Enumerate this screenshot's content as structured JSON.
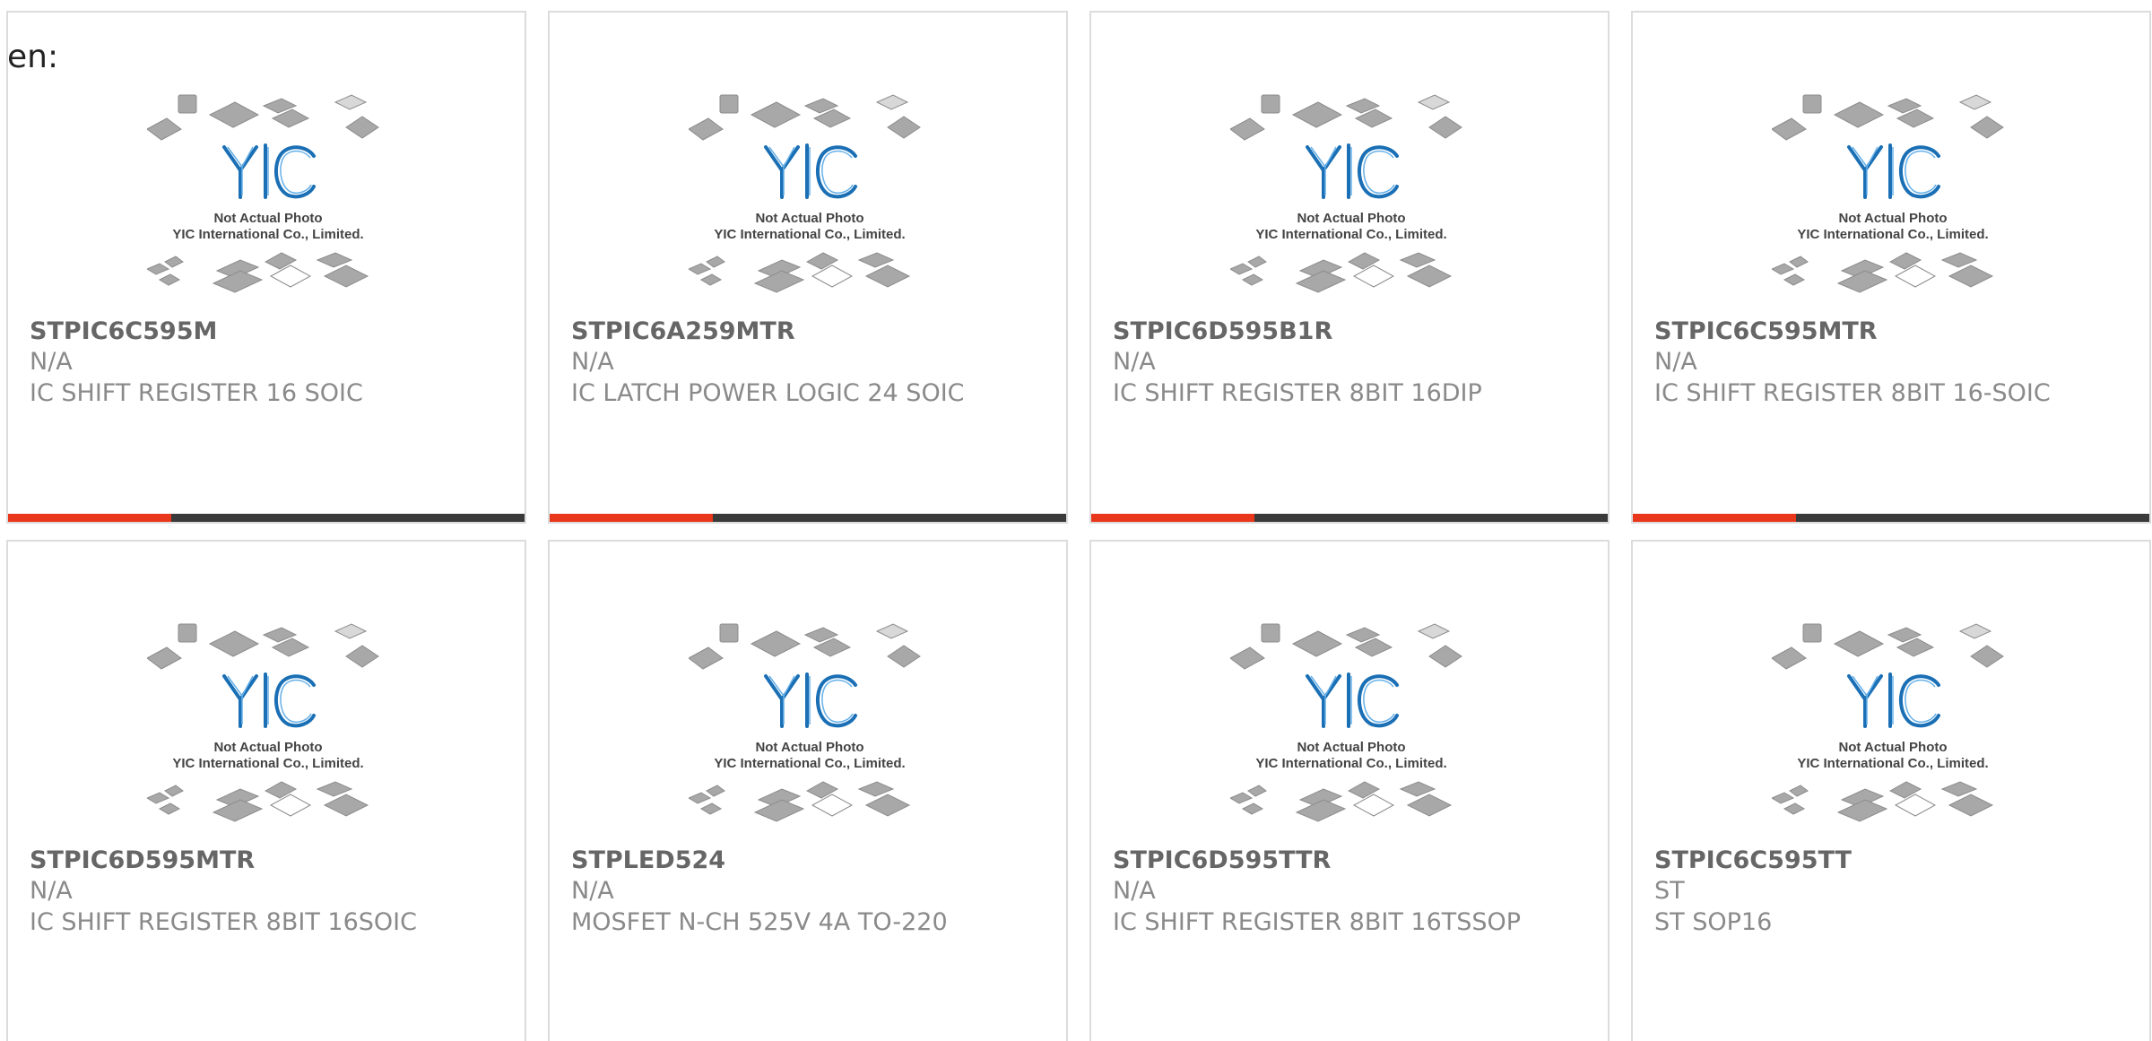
{
  "heading": "en:",
  "placeholder": {
    "caption_line1": "Not Actual Photo",
    "caption_line2": "YIC International Co., Limited.",
    "logo_text": "YIC"
  },
  "colors": {
    "accent": "#e8371b",
    "bar": "#3a3a3a",
    "logo_blue": "#1a6fb5"
  },
  "products": [
    {
      "part": "STPIC6C595M",
      "maker": "N/A",
      "desc": "IC SHIFT REGISTER 16 SOIC"
    },
    {
      "part": "STPIC6A259MTR",
      "maker": "N/A",
      "desc": "IC LATCH POWER LOGIC 24 SOIC"
    },
    {
      "part": "STPIC6D595B1R",
      "maker": "N/A",
      "desc": "IC SHIFT REGISTER 8BIT 16DIP"
    },
    {
      "part": "STPIC6C595MTR",
      "maker": "N/A",
      "desc": "IC SHIFT REGISTER 8BIT 16-SOIC"
    },
    {
      "part": "STPIC6D595MTR",
      "maker": "N/A",
      "desc": "IC SHIFT REGISTER 8BIT 16SOIC"
    },
    {
      "part": "STPLED524",
      "maker": "N/A",
      "desc": "MOSFET N-CH 525V 4A TO-220"
    },
    {
      "part": "STPIC6D595TTR",
      "maker": "N/A",
      "desc": "IC SHIFT REGISTER 8BIT 16TSSOP"
    },
    {
      "part": "STPIC6C595TT",
      "maker": "ST",
      "desc": "ST SOP16"
    }
  ]
}
